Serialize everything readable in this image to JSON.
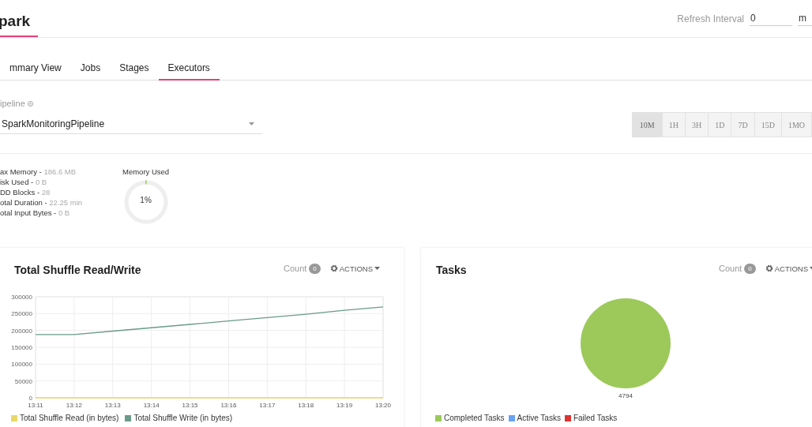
{
  "header": {
    "title": "park",
    "refresh_label": "Refresh Interval",
    "refresh_value": "0",
    "unit_value": "m"
  },
  "tabs": [
    {
      "label": "mmary View",
      "selected": false
    },
    {
      "label": "Jobs",
      "selected": false
    },
    {
      "label": "Stages",
      "selected": false
    },
    {
      "label": "Executors",
      "selected": true
    }
  ],
  "pipeline": {
    "label": "ipeline",
    "value": "SparkMonitoringPipeline"
  },
  "time_ranges": [
    {
      "label": "10M",
      "selected": true
    },
    {
      "label": "1H",
      "selected": false
    },
    {
      "label": "3H",
      "selected": false
    },
    {
      "label": "1D",
      "selected": false
    },
    {
      "label": "7D",
      "selected": false
    },
    {
      "label": "15D",
      "selected": false
    },
    {
      "label": "1MO",
      "selected": false
    }
  ],
  "stats": [
    {
      "name": "ax Memory -",
      "value": "186.6 MB"
    },
    {
      "name": "isk Used -",
      "value": "0 B"
    },
    {
      "name": "DD Blocks -",
      "value": "28"
    },
    {
      "name": "otal Duration -",
      "value": "22.25 min"
    },
    {
      "name": "otal Input Bytes -",
      "value": "0 B"
    }
  ],
  "memory_used": {
    "label": "Memory Used",
    "level": 0.01,
    "reading": "1%"
  },
  "cards": [
    {
      "title": "Total Shuffle Read/Write",
      "count_label": "Count",
      "count": "0",
      "actions": "ACTIONS",
      "chart_data": {
        "type": "line",
        "grid": true,
        "x": [
          "13:11",
          "13:12",
          "13:13",
          "13:14",
          "13:15",
          "13:16",
          "13:17",
          "13:18",
          "13:19",
          "13:20"
        ],
        "ylim": [
          0,
          300000
        ],
        "yticks": [
          0,
          50000,
          100000,
          150000,
          200000,
          250000,
          300000
        ],
        "series": [
          {
            "name": "Total Shuffle Read (in bytes)",
            "color": "#e8d86a",
            "values": [
              0,
              0,
              0,
              0,
              0,
              0,
              0,
              0,
              0,
              0
            ]
          },
          {
            "name": "Total Shuffle Write (in bytes)",
            "color": "#6a9a8a",
            "values": [
              188000,
              188000,
              198000,
              208000,
              218000,
              228000,
              238000,
              248000,
              260000,
              270000
            ]
          }
        ]
      }
    },
    {
      "title": "Tasks",
      "count_label": "Count",
      "count": "0",
      "actions": "ACTIONS",
      "chart_data": {
        "type": "pie",
        "categories": [
          "Completed Tasks",
          "Active Tasks",
          "Failed Tasks"
        ],
        "data_labels": true,
        "values": [
          4794,
          0,
          0
        ],
        "colors": [
          "#9cc95a",
          "#6aa2ee",
          "#dd3333"
        ]
      }
    }
  ]
}
